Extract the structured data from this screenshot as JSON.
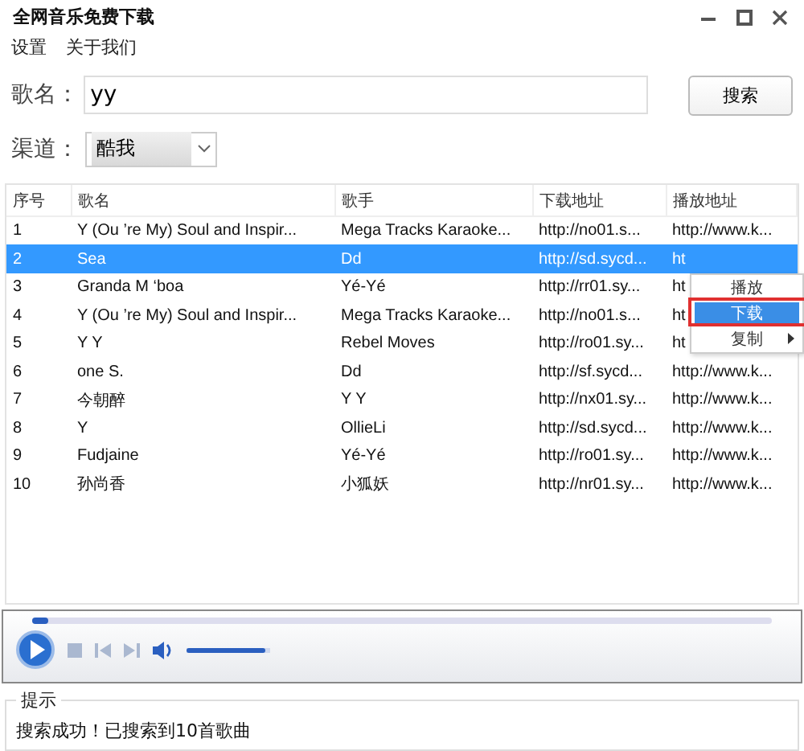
{
  "window": {
    "title": "全网音乐免费下载"
  },
  "menu": [
    "设置",
    "关于我们"
  ],
  "search": {
    "label": "歌名：",
    "value": "yy",
    "button": "搜索"
  },
  "channel": {
    "label": "渠道：",
    "value": "酷我"
  },
  "table": {
    "columns": [
      "序号",
      "歌名",
      "歌手",
      "下载地址",
      "播放地址"
    ],
    "rows": [
      {
        "selected": false,
        "cells": [
          "1",
          "Y (Ou ’re My) Soul and Inspir...",
          "Mega Tracks Karaoke...",
          "http://no01.s...",
          "http://www.k..."
        ]
      },
      {
        "selected": true,
        "cells": [
          "2",
          "Sea",
          "Dd",
          "http://sd.sycd...",
          "ht"
        ]
      },
      {
        "selected": false,
        "cells": [
          "3",
          "Granda M ‘boa",
          "Yé-Yé",
          "http://rr01.sy...",
          "ht"
        ]
      },
      {
        "selected": false,
        "cells": [
          "4",
          "Y (Ou ’re My) Soul and Inspir...",
          "Mega Tracks Karaoke...",
          "http://no01.s...",
          "ht"
        ]
      },
      {
        "selected": false,
        "cells": [
          "5",
          "Y Y",
          "Rebel Moves",
          "http://ro01.sy...",
          "ht"
        ]
      },
      {
        "selected": false,
        "cells": [
          "6",
          "one S.",
          "Dd",
          "http://sf.sycd...",
          "http://www.k..."
        ]
      },
      {
        "selected": false,
        "cells": [
          "7",
          "今朝醉",
          "Y Y",
          "http://nx01.sy...",
          "http://www.k..."
        ]
      },
      {
        "selected": false,
        "cells": [
          "8",
          "Y",
          "OllieLi",
          "http://sd.sycd...",
          "http://www.k..."
        ]
      },
      {
        "selected": false,
        "cells": [
          "9",
          "Fudjaine",
          "Yé-Yé",
          "http://ro01.sy...",
          "http://www.k..."
        ]
      },
      {
        "selected": false,
        "cells": [
          "10",
          "孙尚香",
          "小狐妖",
          "http://nr01.sy...",
          "http://www.k..."
        ]
      }
    ]
  },
  "context_menu": [
    {
      "label": "播放",
      "selected": false,
      "submenu": false
    },
    {
      "label": "下载",
      "selected": true,
      "submenu": false
    },
    {
      "label": "复制",
      "selected": false,
      "submenu": true
    }
  ],
  "player": {
    "position": {
      "level": 0.02
    },
    "volume": {
      "level": 0.95
    }
  },
  "hint": {
    "title": "提示",
    "message": "搜索成功！已搜索到10首歌曲"
  }
}
